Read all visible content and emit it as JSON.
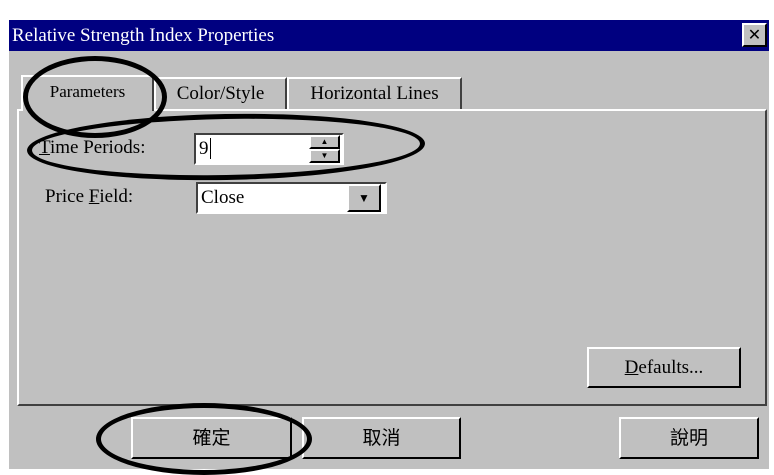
{
  "window": {
    "title": "Relative Strength Index Properties",
    "close_symbol": "✕"
  },
  "tabs": [
    {
      "label": "Parameters",
      "active": true
    },
    {
      "label": "Color/Style",
      "active": false
    },
    {
      "label": "Horizontal Lines",
      "active": false
    }
  ],
  "parameters": {
    "time_periods": {
      "label_mnemonic": "T",
      "label_rest": "ime Periods:",
      "value": "9"
    },
    "price_field": {
      "label_pre": "Price ",
      "label_mnemonic": "F",
      "label_rest": "ield:",
      "value": "Close"
    }
  },
  "buttons": {
    "defaults": {
      "mnemonic": "D",
      "rest": "efaults..."
    },
    "ok": "確定",
    "cancel": "取消",
    "help": "說明"
  },
  "icons": {
    "spin_up": "▲",
    "spin_down": "▼",
    "dropdown": "▼"
  },
  "annotations": {
    "ring_color": "#000000"
  }
}
